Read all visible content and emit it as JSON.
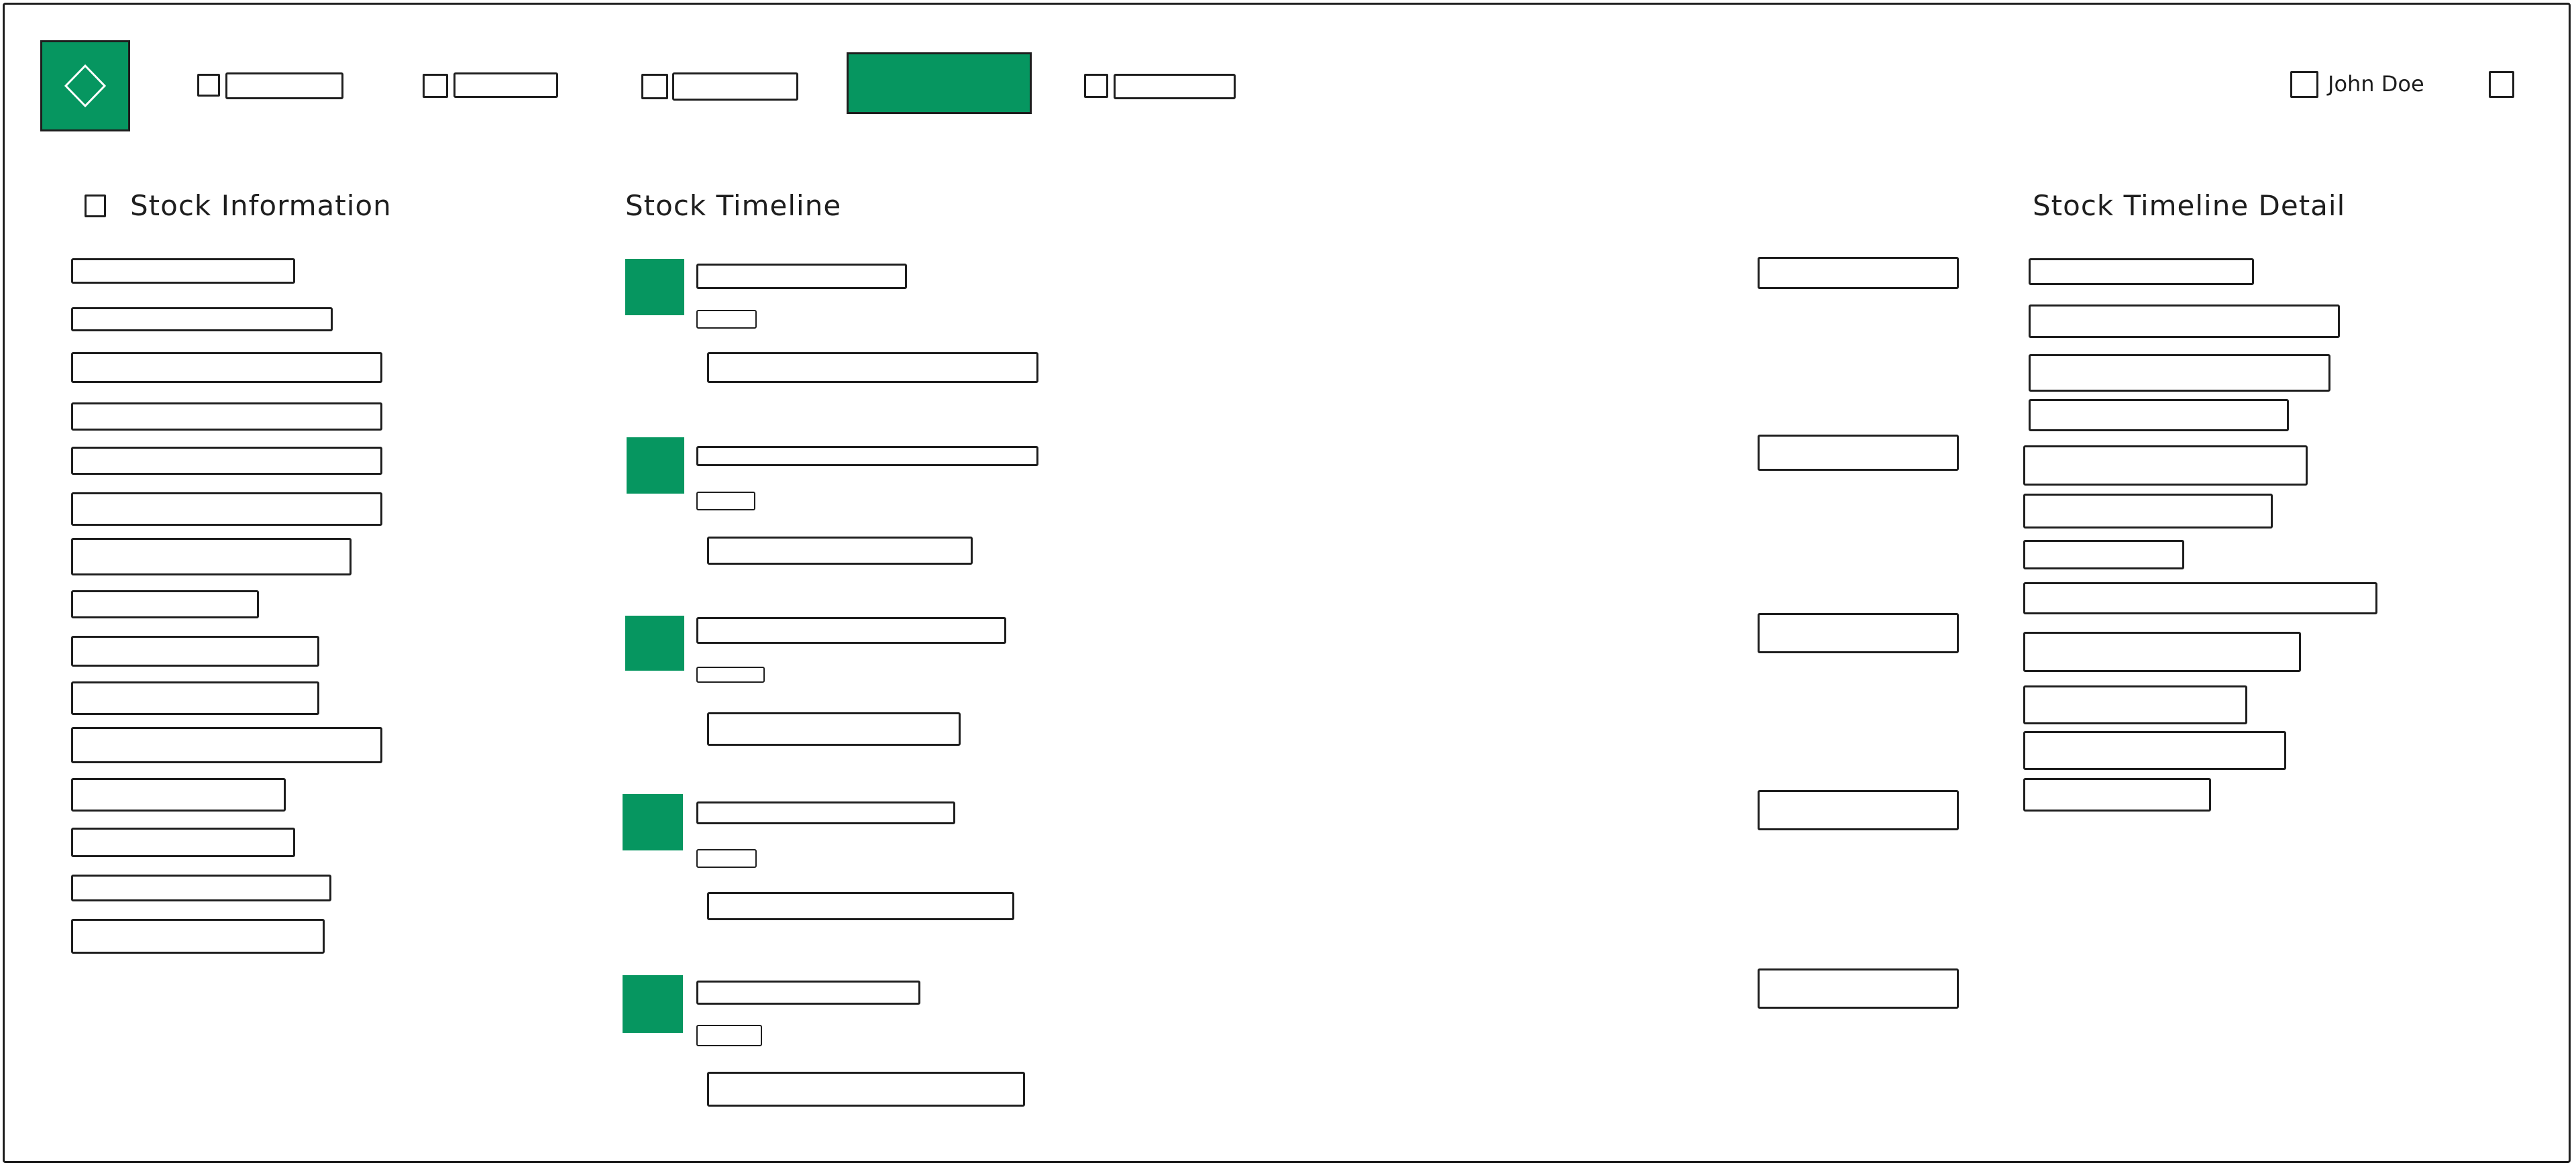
{
  "header": {
    "logo_icon": "diamond-icon",
    "brand_color": "#069660",
    "nav_items": [
      {
        "name": "nav-item-1",
        "icon": "square-icon",
        "label": ""
      },
      {
        "name": "nav-item-2",
        "icon": "square-icon",
        "label": ""
      },
      {
        "name": "nav-item-3",
        "icon": "square-icon",
        "label": ""
      },
      {
        "name": "nav-item-active",
        "icon": "",
        "label": ""
      },
      {
        "name": "nav-item-5",
        "icon": "square-icon",
        "label": ""
      }
    ],
    "user": {
      "name": "John Doe",
      "avatar_icon": "square-icon",
      "menu_icon": "square-icon"
    }
  },
  "stock_information": {
    "title": "Stock Information",
    "title_icon": "square-icon",
    "fields": [
      "",
      "",
      "",
      "",
      "",
      "",
      "",
      "",
      "",
      "",
      "",
      "",
      "",
      "",
      ""
    ]
  },
  "stock_timeline": {
    "title": "Stock Timeline",
    "marker_color": "#069660",
    "entries": [
      {
        "title": "",
        "tag": "",
        "detail": "",
        "side_value": ""
      },
      {
        "title": "",
        "tag": "",
        "detail": "",
        "side_value": ""
      },
      {
        "title": "",
        "tag": "",
        "detail": "",
        "side_value": ""
      },
      {
        "title": "",
        "tag": "",
        "detail": "",
        "side_value": ""
      },
      {
        "title": "",
        "tag": "",
        "detail": "",
        "side_value": ""
      }
    ]
  },
  "stock_timeline_detail": {
    "title": "Stock Timeline Detail",
    "fields": [
      "",
      "",
      "",
      "",
      "",
      "",
      "",
      "",
      "",
      "",
      "",
      ""
    ]
  }
}
